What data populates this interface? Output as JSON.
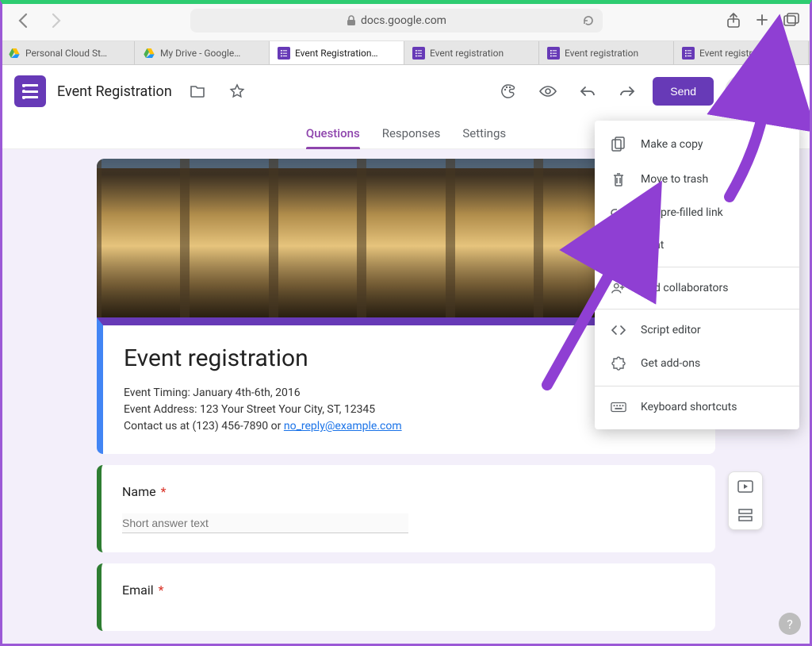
{
  "browser": {
    "url_host": "docs.google.com"
  },
  "tabs": [
    {
      "label": "Personal Cloud St…",
      "type": "drive"
    },
    {
      "label": "My Drive - Google…",
      "type": "drive"
    },
    {
      "label": "Event Registration…",
      "type": "forms",
      "active": true
    },
    {
      "label": "Event registration",
      "type": "forms"
    },
    {
      "label": "Event registration",
      "type": "forms"
    },
    {
      "label": "Event registration",
      "type": "forms"
    }
  ],
  "header": {
    "doc_title": "Event Registration",
    "send_label": "Send"
  },
  "nav_tabs": {
    "questions": "Questions",
    "responses": "Responses",
    "settings": "Settings"
  },
  "form": {
    "title": "Event registration",
    "desc_line1": "Event Timing: January 4th-6th, 2016",
    "desc_line2": "Event Address: 123 Your Street Your City, ST, 12345",
    "desc_line3_pre": "Contact us at (123) 456-7890 or ",
    "desc_link": "no_reply@example.com",
    "q1_label": "Name",
    "q1_placeholder": "Short answer text",
    "q2_label": "Email",
    "required_mark": "*"
  },
  "menu": {
    "copy": "Make a copy",
    "trash": "Move to trash",
    "prefilled": "Get pre-filled link",
    "print": "Print",
    "collab": "Add collaborators",
    "script": "Script editor",
    "addons": "Get add-ons",
    "shortcuts": "Keyboard shortcuts"
  }
}
